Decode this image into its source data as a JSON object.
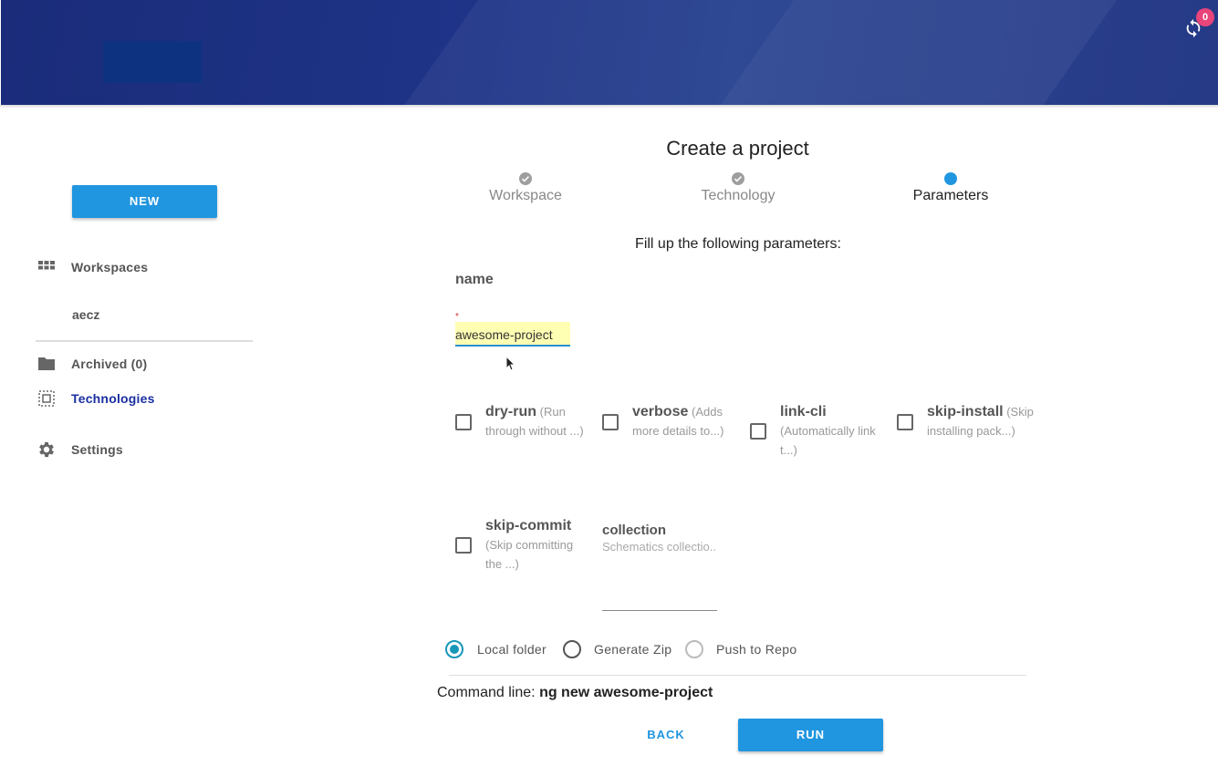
{
  "header": {
    "notification_count": "0",
    "sync_icon": "sync-icon"
  },
  "sidebar": {
    "new_button": "NEW",
    "workspaces_label": "Workspaces",
    "workspace_item": "aecz",
    "archived_label": "Archived (0)",
    "technologies_label": "Technologies",
    "settings_label": "Settings"
  },
  "main": {
    "title": "Create a project",
    "steps": [
      {
        "label": "Workspace",
        "state": "done"
      },
      {
        "label": "Technology",
        "state": "done"
      },
      {
        "label": "Parameters",
        "state": "active"
      }
    ],
    "subtitle": "Fill up the following parameters:",
    "name_field": {
      "label": "name",
      "required_mark": "*",
      "value": "awesome-project"
    },
    "options": [
      {
        "name": "dry-run",
        "desc": "(Run through without ...)"
      },
      {
        "name": "verbose",
        "desc": "(Adds more details to...)"
      },
      {
        "name": "link-cli",
        "desc": "(Automatically link t...)"
      },
      {
        "name": "skip-install",
        "desc": "(Skip installing pack...)"
      },
      {
        "name": "skip-commit",
        "desc": "(Skip committing the ...)"
      }
    ],
    "collection": {
      "label": "collection",
      "placeholder": "Schematics collectio..."
    },
    "output": {
      "options": [
        "Local folder",
        "Generate Zip",
        "Push to Repo"
      ],
      "selected": "Local folder"
    },
    "command_line": {
      "label": "Command line:",
      "value": "ng new awesome-project"
    },
    "back_button": "BACK",
    "run_button": "RUN"
  },
  "colors": {
    "header": "#1f3488",
    "accent": "#2196e0",
    "radio": "#1797b8",
    "badge": "#e8457b",
    "active_nav": "#1a2fa0"
  }
}
